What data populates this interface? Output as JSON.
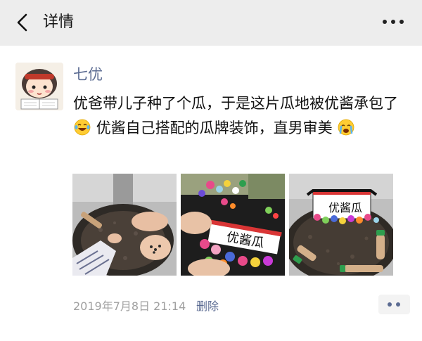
{
  "header": {
    "title": "详情",
    "back_icon": "chevron-left-icon",
    "more_icon": "more-dots-icon"
  },
  "post": {
    "author": "七优",
    "text_segments": [
      "优爸带儿子种了个瓜，于是这片瓜地被优酱承包了",
      "优酱自己搭配的瓜牌装饰，直男审美"
    ],
    "emojis": [
      "laughing-tears-emoji",
      "crying-emoji"
    ],
    "photos": [
      {
        "subject": "hands-planting-seeds-photo"
      },
      {
        "subject": "making-melon-sign-photo",
        "sign_text": "优酱瓜"
      },
      {
        "subject": "decorated-melon-patch-photo",
        "sign_text": "优酱瓜"
      }
    ],
    "timestamp": "2019年7月8日 21:14",
    "delete_label": "删除",
    "comment_icon": "comment-dots-icon"
  },
  "colors": {
    "header_bg": "#ededed",
    "link_blue": "#5b6b92",
    "timestamp_gray": "#a0a0a0",
    "text": "#111111"
  }
}
